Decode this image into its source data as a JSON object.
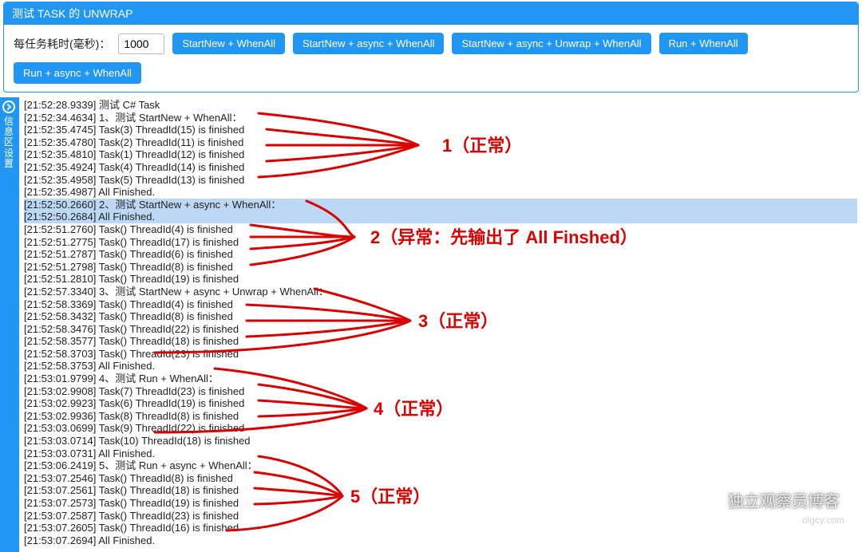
{
  "panel": {
    "title": "测试 TASK 的 UNWRAP",
    "delay_label": "每任务耗时(毫秒)：",
    "delay_value": "1000",
    "buttons": [
      "StartNew + WhenAll",
      "StartNew + async + WhenAll",
      "StartNew + async + Unwrap + WhenAll",
      "Run + WhenAll",
      "Run + async + WhenAll"
    ]
  },
  "side": {
    "c0": "信",
    "c1": "息",
    "c2": "区",
    "c3": "设",
    "c4": "置"
  },
  "log": [
    {
      "t": "[21:52:28.9339] 测试 C# Task",
      "hl": false
    },
    {
      "t": "[21:52:34.4634] 1、测试 StartNew + WhenAll：",
      "hl": false
    },
    {
      "t": "[21:52:35.4745] Task(3) ThreadId(15) is finished",
      "hl": false
    },
    {
      "t": "[21:52:35.4780] Task(2) ThreadId(11) is finished",
      "hl": false
    },
    {
      "t": "[21:52:35.4810] Task(1) ThreadId(12) is finished",
      "hl": false
    },
    {
      "t": "[21:52:35.4924] Task(4) ThreadId(14) is finished",
      "hl": false
    },
    {
      "t": "[21:52:35.4958] Task(5) ThreadId(13) is finished",
      "hl": false
    },
    {
      "t": "[21:52:35.4987] All Finished.",
      "hl": false
    },
    {
      "t": "[21:52:50.2660] 2、测试 StartNew + async + WhenAll：",
      "hl": true
    },
    {
      "t": "[21:52:50.2684] All Finished.",
      "hl": true
    },
    {
      "t": "[21:52:51.2760] Task() ThreadId(4) is finished",
      "hl": false
    },
    {
      "t": "[21:52:51.2775] Task() ThreadId(17) is finished",
      "hl": false
    },
    {
      "t": "[21:52:51.2787] Task() ThreadId(6) is finished",
      "hl": false
    },
    {
      "t": "[21:52:51.2798] Task() ThreadId(8) is finished",
      "hl": false
    },
    {
      "t": "[21:52:51.2810] Task() ThreadId(19) is finished",
      "hl": false
    },
    {
      "t": "[21:52:57.3340] 3、测试 StartNew + async + Unwrap + WhenAll：",
      "hl": false
    },
    {
      "t": "[21:52:58.3369] Task() ThreadId(4) is finished",
      "hl": false
    },
    {
      "t": "[21:52:58.3432] Task() ThreadId(8) is finished",
      "hl": false
    },
    {
      "t": "[21:52:58.3476] Task() ThreadId(22) is finished",
      "hl": false
    },
    {
      "t": "[21:52:58.3577] Task() ThreadId(18) is finished",
      "hl": false
    },
    {
      "t": "[21:52:58.3703] Task() ThreadId(23) is finished",
      "hl": false
    },
    {
      "t": "[21:52:58.3753] All Finished.",
      "hl": false
    },
    {
      "t": "[21:53:01.9799] 4、测试 Run + WhenAll：",
      "hl": false
    },
    {
      "t": "[21:53:02.9908] Task(7) ThreadId(23) is finished",
      "hl": false
    },
    {
      "t": "[21:53:02.9923] Task(6) ThreadId(19) is finished",
      "hl": false
    },
    {
      "t": "[21:53:02.9936] Task(8) ThreadId(8) is finished",
      "hl": false
    },
    {
      "t": "[21:53:03.0699] Task(9) ThreadId(22) is finished",
      "hl": false
    },
    {
      "t": "[21:53:03.0714] Task(10) ThreadId(18) is finished",
      "hl": false
    },
    {
      "t": "[21:53:03.0731] All Finished.",
      "hl": false
    },
    {
      "t": "[21:53:06.2419] 5、测试 Run + async + WhenAll：",
      "hl": false
    },
    {
      "t": "[21:53:07.2546] Task() ThreadId(8) is finished",
      "hl": false
    },
    {
      "t": "[21:53:07.2561] Task() ThreadId(18) is finished",
      "hl": false
    },
    {
      "t": "[21:53:07.2573] Task() ThreadId(19) is finished",
      "hl": false
    },
    {
      "t": "[21:53:07.2587] Task() ThreadId(23) is finished",
      "hl": false
    },
    {
      "t": "[21:53:07.2605] Task() ThreadId(16) is finished",
      "hl": false
    },
    {
      "t": "[21:53:07.2694] All Finished.",
      "hl": false
    }
  ],
  "annotations": {
    "a1": "1（正常）",
    "a2": "2（异常：先输出了 All Finshed）",
    "a3": "3（正常）",
    "a4": "4（正常）",
    "a5": "5（正常）"
  },
  "watermark": {
    "text": "独立观察员博客",
    "url": "dlgcy.com"
  }
}
